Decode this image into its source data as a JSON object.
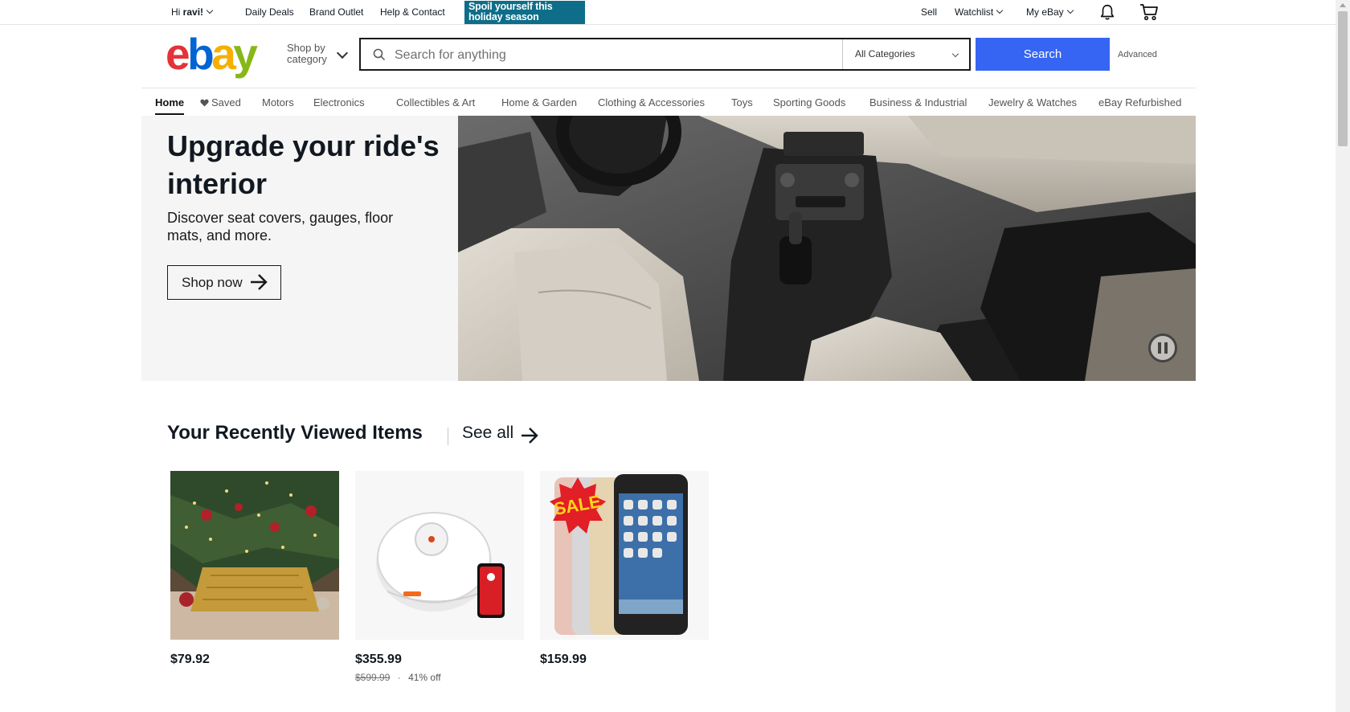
{
  "topbar": {
    "greeting_prefix": "Hi ",
    "greeting_name": "ravi!",
    "links": [
      "Daily Deals",
      "Brand Outlet",
      "Help & Contact"
    ],
    "promo_text": "Spoil yourself this holiday season",
    "sell": "Sell",
    "watchlist": "Watchlist",
    "my_ebay": "My eBay",
    "notification_icon": "bell-icon",
    "cart_icon": "cart-icon"
  },
  "header": {
    "logo_letters": [
      "e",
      "b",
      "a",
      "y"
    ],
    "shop_by_line1": "Shop by",
    "shop_by_line2": "category",
    "search_placeholder": "Search for anything",
    "search_value": "",
    "category_selected": "All Categories",
    "search_button": "Search",
    "advanced": "Advanced"
  },
  "nav": {
    "items": [
      {
        "label": "Home",
        "active": true
      },
      {
        "label": "Saved",
        "icon": "heart-icon"
      },
      {
        "label": "Motors"
      },
      {
        "label": "Electronics"
      },
      {
        "label": "Collectibles & Art"
      },
      {
        "label": "Home & Garden"
      },
      {
        "label": "Clothing & Accessories"
      },
      {
        "label": "Toys"
      },
      {
        "label": "Sporting Goods"
      },
      {
        "label": "Business & Industrial"
      },
      {
        "label": "Jewelry & Watches"
      },
      {
        "label": "eBay Refurbished"
      }
    ]
  },
  "hero": {
    "title": "Upgrade your ride's interior",
    "subtitle": "Discover seat covers, gauges, floor mats, and more.",
    "button": "Shop now",
    "pause_icon": "pause-icon"
  },
  "recently_viewed": {
    "title": "Your Recently Viewed Items",
    "see_all": "See all",
    "items": [
      {
        "price": "$79.92",
        "image": "christmas-tree-skirt"
      },
      {
        "price": "$355.99",
        "original_price": "$599.99",
        "separator": "·",
        "discount": "41% off",
        "image": "robot-vacuum"
      },
      {
        "price": "$159.99",
        "image": "iphone-sale",
        "badge": "SALE"
      }
    ]
  },
  "colors": {
    "search_blue": "#3665f3",
    "promo_teal": "#0e6e8a",
    "ebay_red": "#e53238",
    "ebay_blue": "#0064d2",
    "ebay_yellow": "#f5af02",
    "ebay_green": "#86b817"
  }
}
